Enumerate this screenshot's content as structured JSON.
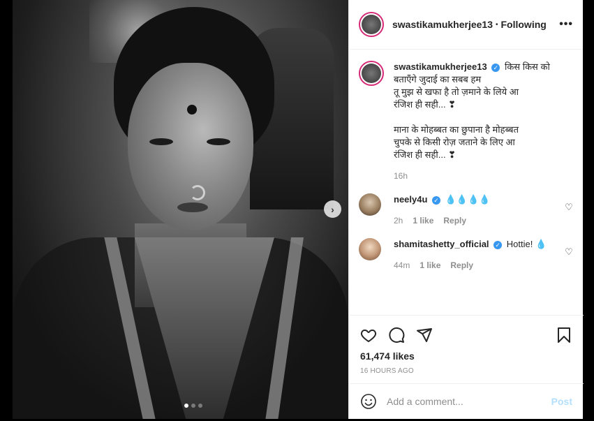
{
  "header": {
    "username": "swastikamukherjee13",
    "separator": "•",
    "follow_label": "Following",
    "more_label": "•••"
  },
  "media": {
    "next_label": "›",
    "carousel_count": 3,
    "carousel_active": 0
  },
  "caption": {
    "username": "swastikamukherjee13",
    "verified_mark": "✓",
    "text": "किस किस को बताएँगे जुदाई का सबब हम\nतू मुझ से खफा है तो ज़माने के लिये आ\nरंजिश ही सही... ❣\n\nमाना के मोहब्बत का छुपाना है मोहब्बत\nचुपके से किसी रोज़ जताने के लिए आ\nरंजिश ही सही... ❣",
    "time": "16h"
  },
  "comments": [
    {
      "username": "neely4u",
      "verified_mark": "✓",
      "text": "💧💧💧💧",
      "time": "2h",
      "likes": "1 like",
      "reply": "Reply",
      "heart": "♡"
    },
    {
      "username": "shamitashetty_official",
      "verified_mark": "✓",
      "text": "Hottie! 💧",
      "time": "44m",
      "likes": "1 like",
      "reply": "Reply",
      "heart": "♡"
    }
  ],
  "actions": {
    "likes": "61,474 likes",
    "timestamp": "16 HOURS AGO"
  },
  "add_comment": {
    "placeholder": "Add a comment...",
    "post_label": "Post"
  },
  "colors": {
    "verified": "#3897f0",
    "post_disabled": "#b2dffc",
    "story_ring": "#d62976"
  }
}
